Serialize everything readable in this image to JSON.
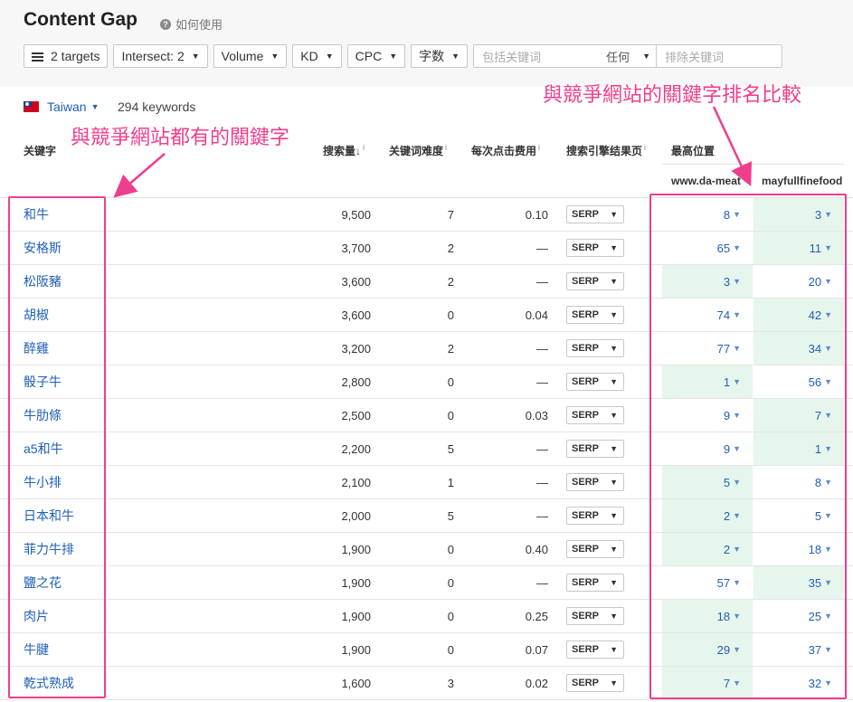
{
  "header": {
    "title": "Content Gap",
    "help_label": "如何使用",
    "help_icon": "?"
  },
  "filters": {
    "targets": "2 targets",
    "intersect": "Intersect: 2",
    "volume": "Volume",
    "kd": "KD",
    "cpc": "CPC",
    "word_count": "字数",
    "include_placeholder": "包括关键词",
    "match_mode": "任何",
    "exclude_placeholder": "排除关键词"
  },
  "country": {
    "name": "Taiwan",
    "keyword_count": "294 keywords"
  },
  "table": {
    "headers": {
      "keyword": "关键字",
      "volume": "搜索量",
      "volume_sort": "↓",
      "kd": "关键词难度",
      "cpc": "每次点击费用",
      "serp": "搜索引擎结果页",
      "position": "最高位置",
      "info": "i",
      "site1": "www.da-meat",
      "site2": "mayfullfinefood"
    },
    "serp_label": "SERP",
    "rows": [
      {
        "keyword": "和牛",
        "volume": "9,500",
        "kd": "7",
        "cpc": "0.10",
        "pos1": "8",
        "pos2": "3",
        "best": "pos2"
      },
      {
        "keyword": "安格斯",
        "volume": "3,700",
        "kd": "2",
        "cpc": "—",
        "pos1": "65",
        "pos2": "11",
        "best": "pos2"
      },
      {
        "keyword": "松阪豬",
        "volume": "3,600",
        "kd": "2",
        "cpc": "—",
        "pos1": "3",
        "pos2": "20",
        "best": "pos1"
      },
      {
        "keyword": "胡椒",
        "volume": "3,600",
        "kd": "0",
        "cpc": "0.04",
        "pos1": "74",
        "pos2": "42",
        "best": "pos2"
      },
      {
        "keyword": "醉雞",
        "volume": "3,200",
        "kd": "2",
        "cpc": "—",
        "pos1": "77",
        "pos2": "34",
        "best": "pos2"
      },
      {
        "keyword": "骰子牛",
        "volume": "2,800",
        "kd": "0",
        "cpc": "—",
        "pos1": "1",
        "pos2": "56",
        "best": "pos1"
      },
      {
        "keyword": "牛肋條",
        "volume": "2,500",
        "kd": "0",
        "cpc": "0.03",
        "pos1": "9",
        "pos2": "7",
        "best": "pos2"
      },
      {
        "keyword": "a5和牛",
        "volume": "2,200",
        "kd": "5",
        "cpc": "—",
        "pos1": "9",
        "pos2": "1",
        "best": "pos2"
      },
      {
        "keyword": "牛小排",
        "volume": "2,100",
        "kd": "1",
        "cpc": "—",
        "pos1": "5",
        "pos2": "8",
        "best": "pos1"
      },
      {
        "keyword": "日本和牛",
        "volume": "2,000",
        "kd": "5",
        "cpc": "—",
        "pos1": "2",
        "pos2": "5",
        "best": "pos1"
      },
      {
        "keyword": "菲力牛排",
        "volume": "1,900",
        "kd": "0",
        "cpc": "0.40",
        "pos1": "2",
        "pos2": "18",
        "best": "pos1"
      },
      {
        "keyword": "鹽之花",
        "volume": "1,900",
        "kd": "0",
        "cpc": "—",
        "pos1": "57",
        "pos2": "35",
        "best": "pos2"
      },
      {
        "keyword": "肉片",
        "volume": "1,900",
        "kd": "0",
        "cpc": "0.25",
        "pos1": "18",
        "pos2": "25",
        "best": "pos1"
      },
      {
        "keyword": "牛腱",
        "volume": "1,900",
        "kd": "0",
        "cpc": "0.07",
        "pos1": "29",
        "pos2": "37",
        "best": "pos1"
      },
      {
        "keyword": "乾式熟成",
        "volume": "1,600",
        "kd": "3",
        "cpc": "0.02",
        "pos1": "7",
        "pos2": "32",
        "best": "pos1"
      }
    ]
  },
  "annotations": {
    "left_label": "與競爭網站都有的關鍵字",
    "right_label": "與競爭網站的關鍵字排名比較",
    "color": "#ef3e8c"
  },
  "colors": {
    "link": "#1f5fb8",
    "best_position_bg": "#e6f6ec"
  }
}
